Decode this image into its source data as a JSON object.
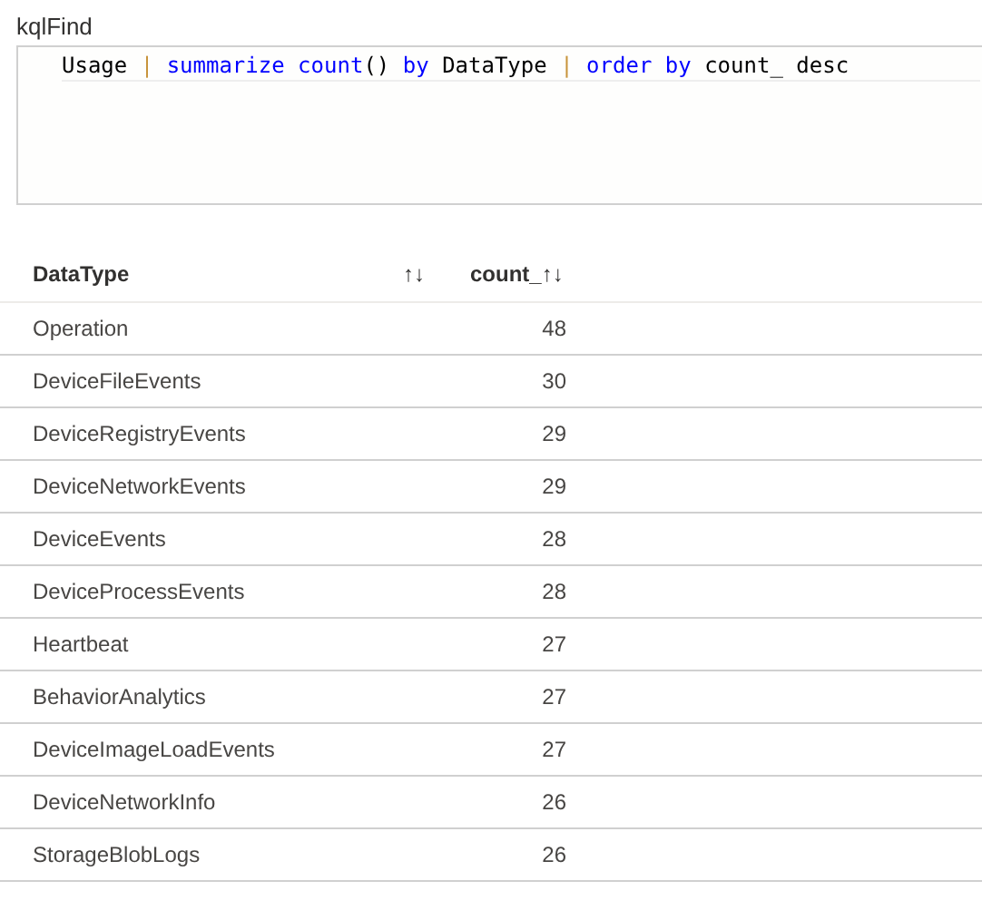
{
  "query_title": "kqlFind",
  "query_tokens": [
    {
      "text": "Usage ",
      "kind": "plain"
    },
    {
      "text": "| ",
      "kind": "pipe"
    },
    {
      "text": "summarize count",
      "kind": "keyword"
    },
    {
      "text": "() ",
      "kind": "plain"
    },
    {
      "text": "by ",
      "kind": "keyword"
    },
    {
      "text": "DataType ",
      "kind": "plain"
    },
    {
      "text": "| ",
      "kind": "pipe"
    },
    {
      "text": "order by ",
      "kind": "keyword"
    },
    {
      "text": "count_ desc",
      "kind": "plain"
    }
  ],
  "table": {
    "columns": [
      {
        "label": "DataType",
        "sort_icon": "↑↓"
      },
      {
        "label": "count_",
        "sort_icon": "↑↓"
      }
    ],
    "rows": [
      [
        "Operation",
        "48"
      ],
      [
        "DeviceFileEvents",
        "30"
      ],
      [
        "DeviceRegistryEvents",
        "29"
      ],
      [
        "DeviceNetworkEvents",
        "29"
      ],
      [
        "DeviceEvents",
        "28"
      ],
      [
        "DeviceProcessEvents",
        "28"
      ],
      [
        "Heartbeat",
        "27"
      ],
      [
        "BehaviorAnalytics",
        "27"
      ],
      [
        "DeviceImageLoadEvents",
        "27"
      ],
      [
        "DeviceNetworkInfo",
        "26"
      ],
      [
        "StorageBlobLogs",
        "26"
      ]
    ]
  }
}
